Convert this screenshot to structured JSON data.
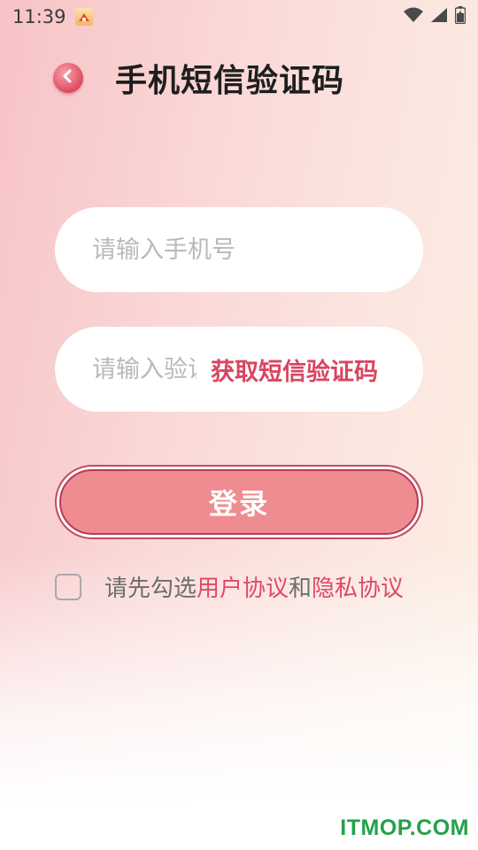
{
  "status_bar": {
    "time": "11:39",
    "icons": [
      "app-notification-icon",
      "wifi-icon",
      "cellular-signal-icon",
      "battery-icon"
    ]
  },
  "header": {
    "back_icon": "back-arrow-icon",
    "title": "手机短信验证码"
  },
  "form": {
    "phone_input": {
      "placeholder": "请输入手机号",
      "value": ""
    },
    "code_input": {
      "placeholder": "请输入验证码",
      "value": ""
    },
    "get_code_label": "获取短信验证码",
    "login_label": "登录"
  },
  "agreement": {
    "checked": false,
    "prefix": "请先勾选",
    "user_agreement": "用户协议",
    "conjunction": "和",
    "privacy_policy": "隐私协议"
  },
  "watermark": "ITMOP.COM",
  "colors": {
    "accent": "#dd4a66",
    "button_fill": "#ee8c91",
    "button_border": "#b83a52",
    "watermark": "#22a24a"
  }
}
